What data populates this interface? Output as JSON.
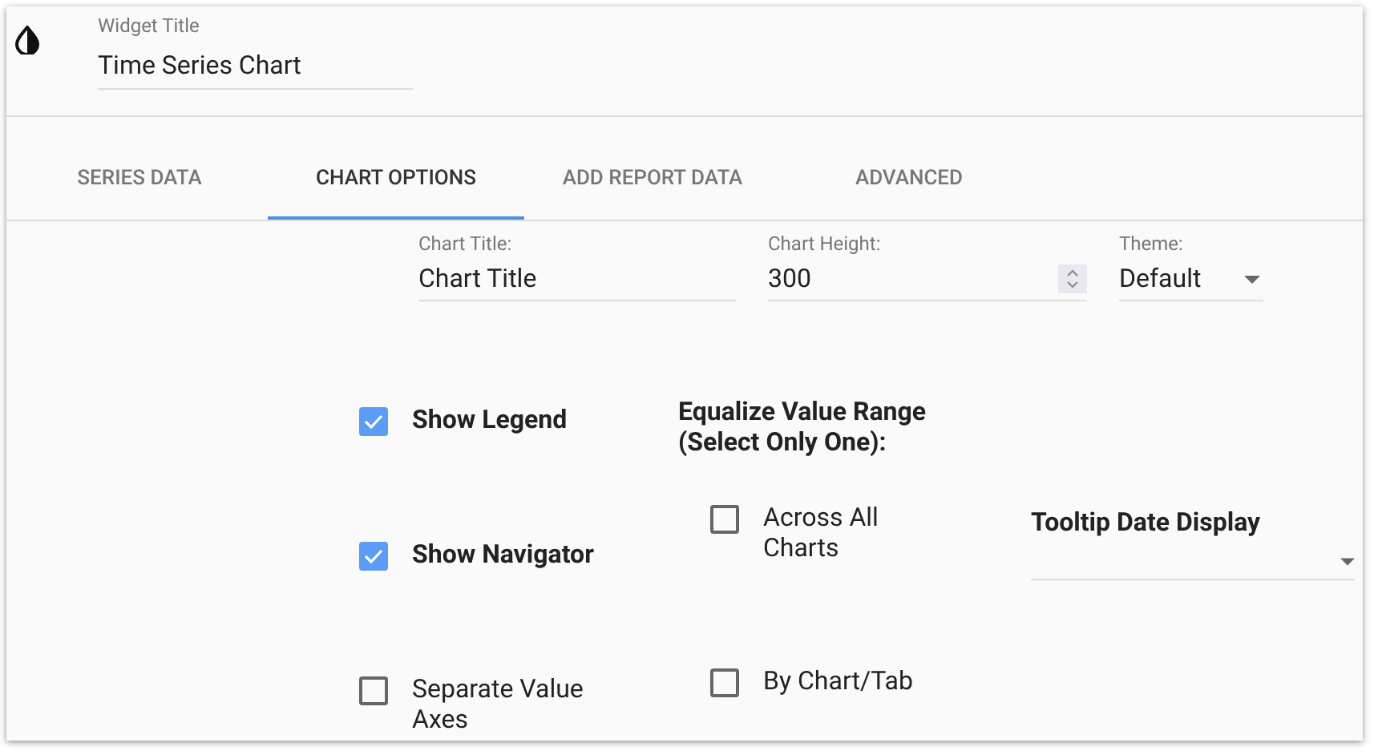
{
  "widget_title": {
    "label": "Widget Title",
    "value": "Time Series Chart"
  },
  "tabs": [
    {
      "label": "SERIES DATA",
      "selected": false
    },
    {
      "label": "CHART OPTIONS",
      "selected": true
    },
    {
      "label": "ADD REPORT DATA",
      "selected": false
    },
    {
      "label": "ADVANCED",
      "selected": false
    }
  ],
  "fields": [
    {
      "kind": "text",
      "label": "Chart Title:",
      "value": "Chart Title"
    },
    {
      "kind": "number",
      "label": "Chart Height:",
      "value": "300"
    },
    {
      "kind": "select",
      "label": "Theme:",
      "value": "Default"
    }
  ],
  "options": [
    {
      "label": "Show Legend",
      "checked": true
    },
    {
      "label": "Show Navigator",
      "checked": true
    },
    {
      "label": "Separate Value Axes",
      "checked": false
    }
  ],
  "equalize": {
    "heading": "Equalize Value Range (Select Only One):",
    "options": [
      {
        "label": "Across All Charts",
        "checked": false
      },
      {
        "label": "By Chart/Tab",
        "checked": false
      }
    ]
  },
  "tooltip_date_display": {
    "label": "Tooltip Date Display"
  }
}
